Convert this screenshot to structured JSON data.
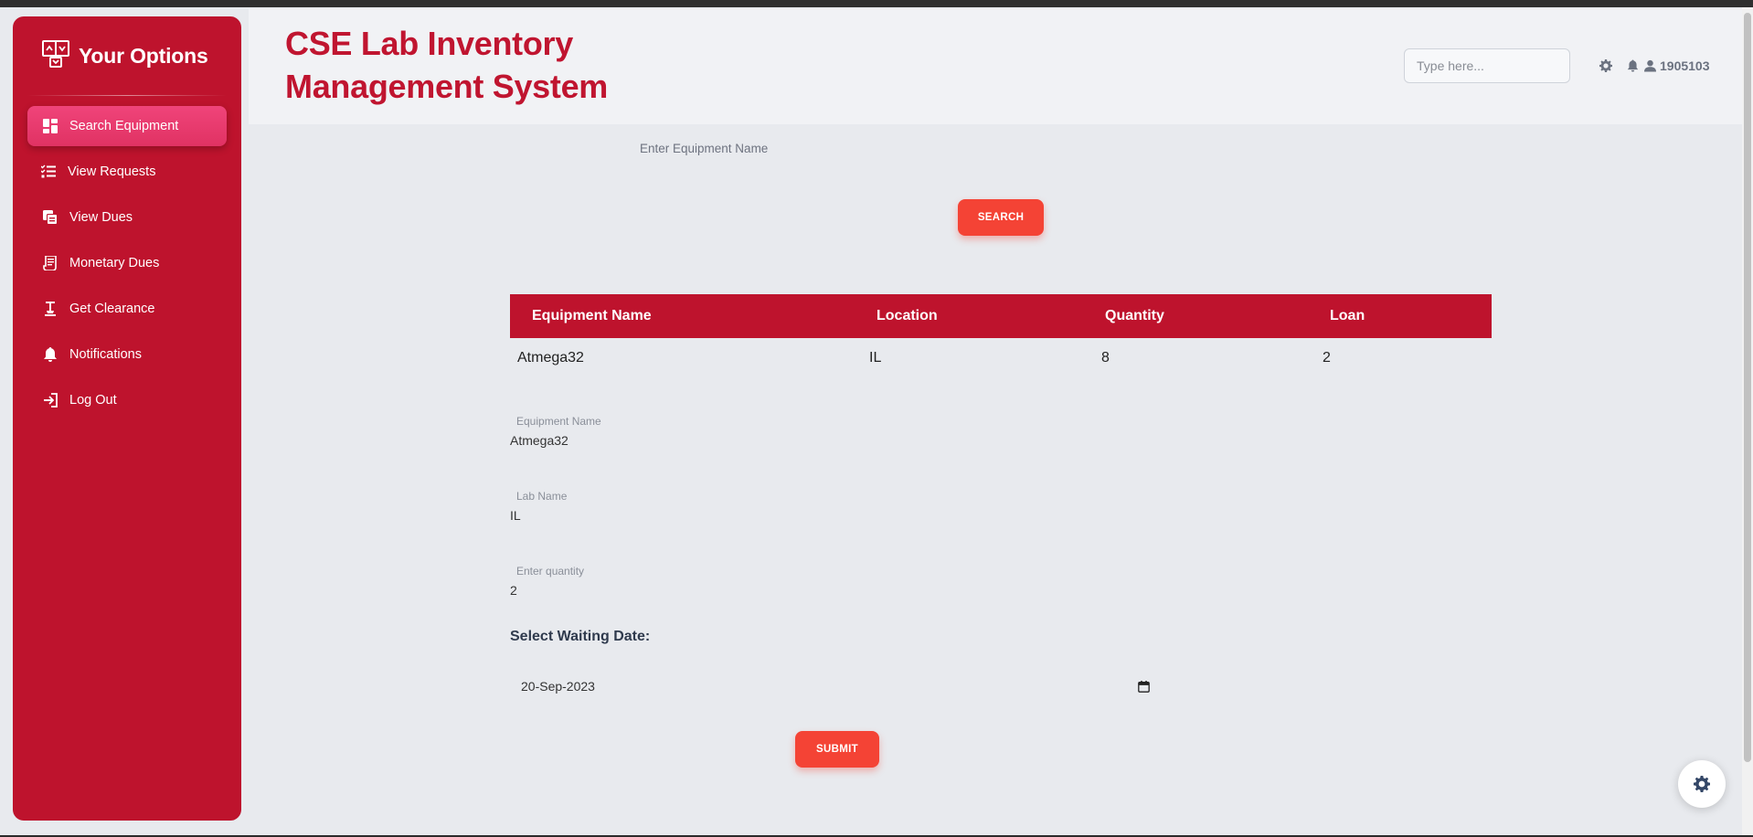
{
  "sidebar": {
    "brand_title": "Your Options",
    "items": [
      {
        "label": "Search Equipment",
        "icon": "dashboard-icon",
        "active": true
      },
      {
        "label": "View Requests",
        "icon": "list-check-icon",
        "active": false
      },
      {
        "label": "View Dues",
        "icon": "copy-icon",
        "active": false
      },
      {
        "label": "Monetary Dues",
        "icon": "receipt-icon",
        "active": false
      },
      {
        "label": "Get Clearance",
        "icon": "clearance-icon",
        "active": false
      },
      {
        "label": "Notifications",
        "icon": "bell-icon",
        "active": false
      },
      {
        "label": "Log Out",
        "icon": "logout-icon",
        "active": false
      }
    ]
  },
  "header": {
    "title": "CSE Lab Inventory Management System",
    "search_placeholder": "Type here...",
    "user_id": "1905103"
  },
  "main": {
    "equipment_input_placeholder": "Enter Equipment Name",
    "search_button": "SEARCH",
    "table": {
      "columns": [
        "Equipment Name",
        "Location",
        "Quantity",
        "Loan"
      ],
      "rows": [
        [
          "Atmega32",
          "IL",
          "8",
          "2"
        ]
      ]
    },
    "form": {
      "equipment_name_label": "Equipment Name",
      "equipment_name_value": "Atmega32",
      "lab_name_label": "Lab Name",
      "lab_name_value": "IL",
      "quantity_label": "Enter quantity",
      "quantity_value": "2",
      "date_label": "Select Waiting Date:",
      "date_value": "20-Sep-2023",
      "submit_button": "SUBMIT"
    }
  },
  "colors": {
    "brand": "#be132d",
    "active_nav": "#e8386d",
    "button": "#f44335"
  }
}
